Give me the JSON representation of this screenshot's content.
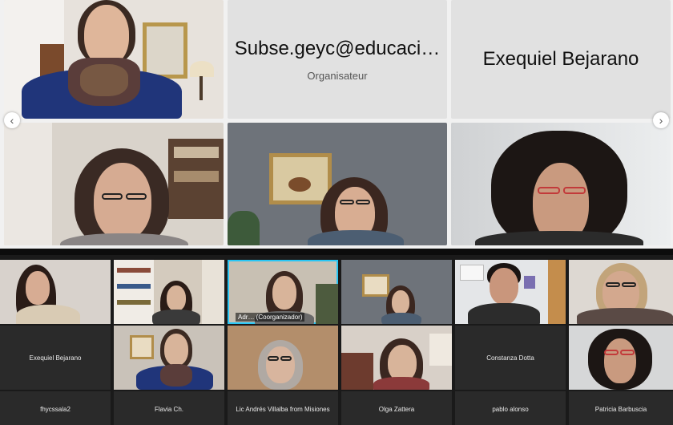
{
  "top_grid": {
    "tiles": [
      {
        "type": "video"
      },
      {
        "type": "name",
        "name": "Subse.geyc@educaci…",
        "role": "Organisateur"
      },
      {
        "type": "name",
        "name": "Exequiel Bejarano"
      },
      {
        "type": "video"
      },
      {
        "type": "video"
      },
      {
        "type": "video"
      }
    ],
    "prev_arrow": "‹",
    "next_arrow": "›"
  },
  "bottom_grid": {
    "row1": [
      {
        "type": "video"
      },
      {
        "type": "video"
      },
      {
        "type": "video",
        "label": "Adr…  (Coorganizador)",
        "active": true
      },
      {
        "type": "video"
      },
      {
        "type": "video"
      },
      {
        "type": "video"
      }
    ],
    "row2": [
      {
        "type": "name",
        "name": "Exequiel Bejarano"
      },
      {
        "type": "video"
      },
      {
        "type": "video"
      },
      {
        "type": "video"
      },
      {
        "type": "name",
        "name": "Constanza Dotta"
      },
      {
        "type": "video"
      }
    ],
    "row3": [
      {
        "name": "fhycssala2"
      },
      {
        "name": "Flavia Ch."
      },
      {
        "name": "Lic Andrés Villalba from Misiones"
      },
      {
        "name": "Olga Zattera"
      },
      {
        "name": "pablo alonso"
      },
      {
        "name": "Patricia Barbuscia"
      }
    ]
  },
  "colors": {
    "zoom_active_border": "#29c6f4",
    "teams_bg": "#f1f1f1",
    "zoom_bg": "#1a1a1a"
  }
}
